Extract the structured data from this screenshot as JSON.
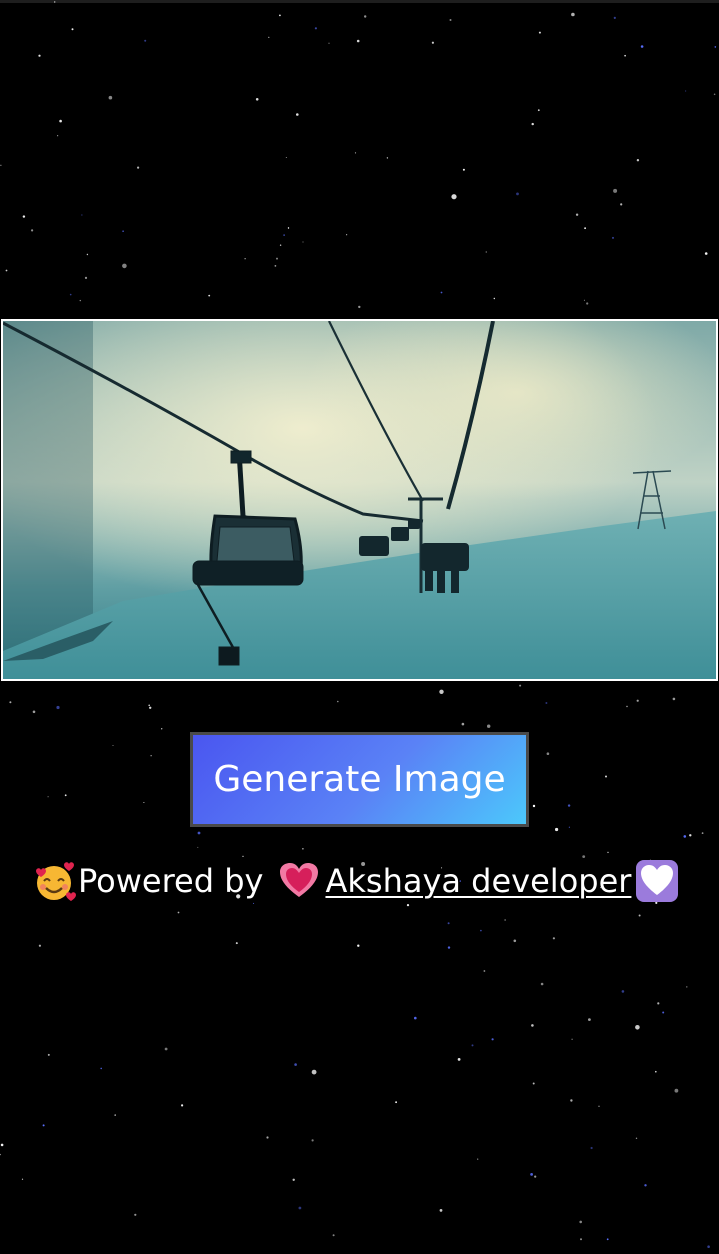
{
  "hero_image": {
    "description_icon": "ski-chairlift-image"
  },
  "generate_button": {
    "label": "Generate Image"
  },
  "credit": {
    "prefix": "Powered by",
    "developer_name": "Akshaya developer",
    "emoji_left": "smiling-face-with-hearts",
    "emoji_heart": "growing-heart",
    "emoji_end": "white-heart"
  },
  "colors": {
    "background": "#000000",
    "button_gradient_start": "#4a56f0",
    "button_gradient_end": "#4cc8fb",
    "text": "#ffffff"
  }
}
